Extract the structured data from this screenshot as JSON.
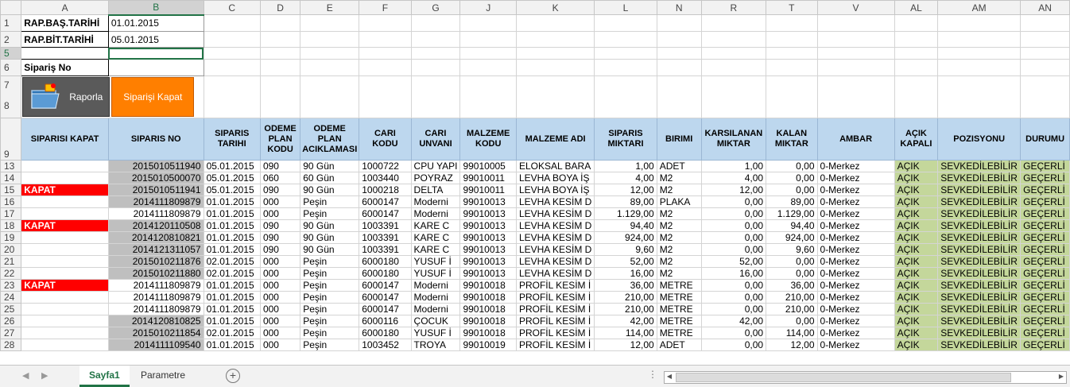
{
  "columns": [
    "A",
    "B",
    "C",
    "D",
    "E",
    "F",
    "G",
    "J",
    "K",
    "L",
    "N",
    "R",
    "T",
    "V",
    "AL",
    "AM",
    "AN"
  ],
  "rows": {
    "r1": {
      "num": "1",
      "label": "RAP.BAŞ.TARİHİ",
      "value": "01.01.2015"
    },
    "r2": {
      "num": "2",
      "label": "RAP.BİT.TARİHİ",
      "value": "05.01.2015"
    },
    "r5": {
      "num": "5"
    },
    "r6": {
      "num": "6",
      "label": "Sipariş No"
    },
    "r7": {
      "num": "7"
    },
    "r8": {
      "num": "8"
    },
    "r9": {
      "num": "9"
    }
  },
  "buttons": {
    "raporla": "Raporla",
    "kapat": "Siparişi Kapat"
  },
  "headers": [
    "SIPARISI KAPAT",
    "SIPARIS NO",
    "SIPARIS TARIHI",
    "ODEME PLAN KODU",
    "ODEME PLAN ACIKLAMASI",
    "CARI KODU",
    "CARI UNVANI",
    "MALZEME KODU",
    "MALZEME ADI",
    "SIPARIS MIKTARI",
    "BIRIMI",
    "KARSILANAN MIKTAR",
    "KALAN MIKTAR",
    "AMBAR",
    "AÇIK KAPALI",
    "POZISYONU",
    "DURUMU"
  ],
  "data_rows": [
    {
      "row": "13",
      "kapat": "",
      "sipno": "2015010511940",
      "gray": true,
      "tarih": "05.01.2015",
      "kod": "090",
      "acik": "90 Gün",
      "cari": "1000722",
      "unvan": "CPU YAPI",
      "mkod": "99010005",
      "madi": "ELOKSAL BARA",
      "mikt": "1,00",
      "birim": "ADET",
      "kars": "1,00",
      "kalan": "0,00",
      "ambar": "0-Merkez",
      "durum": "AÇIK",
      "poz": "SEVKEDİLEBİLİR",
      "gec": "GEÇERLİ"
    },
    {
      "row": "14",
      "kapat": "",
      "sipno": "2015010500070",
      "gray": true,
      "tarih": "05.01.2015",
      "kod": "060",
      "acik": "60 Gün",
      "cari": "1003440",
      "unvan": "POYRAZ",
      "mkod": "99010011",
      "madi": "LEVHA BOYA İŞ",
      "mikt": "4,00",
      "birim": "M2",
      "kars": "4,00",
      "kalan": "0,00",
      "ambar": "0-Merkez",
      "durum": "AÇIK",
      "poz": "SEVKEDİLEBİLİR",
      "gec": "GEÇERLİ"
    },
    {
      "row": "15",
      "kapat": "KAPAT",
      "sipno": "2015010511941",
      "gray": true,
      "tarih": "05.01.2015",
      "kod": "090",
      "acik": "90 Gün",
      "cari": "1000218",
      "unvan": "DELTA",
      "mkod": "99010011",
      "madi": "LEVHA BOYA İŞ",
      "mikt": "12,00",
      "birim": "M2",
      "kars": "12,00",
      "kalan": "0,00",
      "ambar": "0-Merkez",
      "durum": "AÇIK",
      "poz": "SEVKEDİLEBİLİR",
      "gec": "GEÇERLİ"
    },
    {
      "row": "16",
      "kapat": "",
      "sipno": "2014111809879",
      "gray": true,
      "tarih": "01.01.2015",
      "kod": "000",
      "acik": "Peşin",
      "cari": "6000147",
      "unvan": "Moderni",
      "mkod": "99010013",
      "madi": "LEVHA KESİM D",
      "mikt": "89,00",
      "birim": "PLAKA",
      "kars": "0,00",
      "kalan": "89,00",
      "ambar": "0-Merkez",
      "durum": "AÇIK",
      "poz": "SEVKEDİLEBİLİR",
      "gec": "GEÇERLİ"
    },
    {
      "row": "17",
      "kapat": "",
      "sipno": "2014111809879",
      "gray": false,
      "tarih": "01.01.2015",
      "kod": "000",
      "acik": "Peşin",
      "cari": "6000147",
      "unvan": "Moderni",
      "mkod": "99010013",
      "madi": "LEVHA KESİM D",
      "mikt": "1.129,00",
      "birim": "M2",
      "kars": "0,00",
      "kalan": "1.129,00",
      "ambar": "0-Merkez",
      "durum": "AÇIK",
      "poz": "SEVKEDİLEBİLİR",
      "gec": "GEÇERLİ"
    },
    {
      "row": "18",
      "kapat": "KAPAT",
      "sipno": "2014120110508",
      "gray": true,
      "tarih": "01.01.2015",
      "kod": "090",
      "acik": "90 Gün",
      "cari": "1003391",
      "unvan": "KARE C",
      "mkod": "99010013",
      "madi": "LEVHA KESİM D",
      "mikt": "94,40",
      "birim": "M2",
      "kars": "0,00",
      "kalan": "94,40",
      "ambar": "0-Merkez",
      "durum": "AÇIK",
      "poz": "SEVKEDİLEBİLİR",
      "gec": "GEÇERLİ"
    },
    {
      "row": "19",
      "kapat": "",
      "sipno": "2014120810821",
      "gray": true,
      "tarih": "01.01.2015",
      "kod": "090",
      "acik": "90 Gün",
      "cari": "1003391",
      "unvan": "KARE C",
      "mkod": "99010013",
      "madi": "LEVHA KESİM D",
      "mikt": "924,00",
      "birim": "M2",
      "kars": "0,00",
      "kalan": "924,00",
      "ambar": "0-Merkez",
      "durum": "AÇIK",
      "poz": "SEVKEDİLEBİLİR",
      "gec": "GEÇERLİ"
    },
    {
      "row": "20",
      "kapat": "",
      "sipno": "2014121311057",
      "gray": true,
      "tarih": "01.01.2015",
      "kod": "090",
      "acik": "90 Gün",
      "cari": "1003391",
      "unvan": "KARE C",
      "mkod": "99010013",
      "madi": "LEVHA KESİM D",
      "mikt": "9,60",
      "birim": "M2",
      "kars": "0,00",
      "kalan": "9,60",
      "ambar": "0-Merkez",
      "durum": "AÇIK",
      "poz": "SEVKEDİLEBİLİR",
      "gec": "GEÇERLİ"
    },
    {
      "row": "21",
      "kapat": "",
      "sipno": "2015010211876",
      "gray": true,
      "tarih": "02.01.2015",
      "kod": "000",
      "acik": "Peşin",
      "cari": "6000180",
      "unvan": "YUSUF İ",
      "mkod": "99010013",
      "madi": "LEVHA KESİM D",
      "mikt": "52,00",
      "birim": "M2",
      "kars": "52,00",
      "kalan": "0,00",
      "ambar": "0-Merkez",
      "durum": "AÇIK",
      "poz": "SEVKEDİLEBİLİR",
      "gec": "GEÇERLİ"
    },
    {
      "row": "22",
      "kapat": "",
      "sipno": "2015010211880",
      "gray": true,
      "tarih": "02.01.2015",
      "kod": "000",
      "acik": "Peşin",
      "cari": "6000180",
      "unvan": "YUSUF İ",
      "mkod": "99010013",
      "madi": "LEVHA KESİM D",
      "mikt": "16,00",
      "birim": "M2",
      "kars": "16,00",
      "kalan": "0,00",
      "ambar": "0-Merkez",
      "durum": "AÇIK",
      "poz": "SEVKEDİLEBİLİR",
      "gec": "GEÇERLİ"
    },
    {
      "row": "23",
      "kapat": "KAPAT",
      "sipno": "2014111809879",
      "gray": false,
      "tarih": "01.01.2015",
      "kod": "000",
      "acik": "Peşin",
      "cari": "6000147",
      "unvan": "Moderni",
      "mkod": "99010018",
      "madi": "PROFİL KESİM İ",
      "mikt": "36,00",
      "birim": "METRE",
      "kars": "0,00",
      "kalan": "36,00",
      "ambar": "0-Merkez",
      "durum": "AÇIK",
      "poz": "SEVKEDİLEBİLİR",
      "gec": "GEÇERLİ"
    },
    {
      "row": "24",
      "kapat": "",
      "sipno": "2014111809879",
      "gray": false,
      "tarih": "01.01.2015",
      "kod": "000",
      "acik": "Peşin",
      "cari": "6000147",
      "unvan": "Moderni",
      "mkod": "99010018",
      "madi": "PROFİL KESİM İ",
      "mikt": "210,00",
      "birim": "METRE",
      "kars": "0,00",
      "kalan": "210,00",
      "ambar": "0-Merkez",
      "durum": "AÇIK",
      "poz": "SEVKEDİLEBİLİR",
      "gec": "GEÇERLİ"
    },
    {
      "row": "25",
      "kapat": "",
      "sipno": "2014111809879",
      "gray": false,
      "tarih": "01.01.2015",
      "kod": "000",
      "acik": "Peşin",
      "cari": "6000147",
      "unvan": "Moderni",
      "mkod": "99010018",
      "madi": "PROFİL KESİM İ",
      "mikt": "210,00",
      "birim": "METRE",
      "kars": "0,00",
      "kalan": "210,00",
      "ambar": "0-Merkez",
      "durum": "AÇIK",
      "poz": "SEVKEDİLEBİLİR",
      "gec": "GEÇERLİ"
    },
    {
      "row": "26",
      "kapat": "",
      "sipno": "2014120810825",
      "gray": true,
      "tarih": "01.01.2015",
      "kod": "000",
      "acik": "Peşin",
      "cari": "6000116",
      "unvan": "ÇOCUK",
      "mkod": "99010018",
      "madi": "PROFİL KESİM İ",
      "mikt": "42,00",
      "birim": "METRE",
      "kars": "42,00",
      "kalan": "0,00",
      "ambar": "0-Merkez",
      "durum": "AÇIK",
      "poz": "SEVKEDİLEBİLİR",
      "gec": "GEÇERLİ"
    },
    {
      "row": "27",
      "kapat": "",
      "sipno": "2015010211854",
      "gray": true,
      "tarih": "02.01.2015",
      "kod": "000",
      "acik": "Peşin",
      "cari": "6000180",
      "unvan": "YUSUF İ",
      "mkod": "99010018",
      "madi": "PROFİL KESİM İ",
      "mikt": "114,00",
      "birim": "METRE",
      "kars": "0,00",
      "kalan": "114,00",
      "ambar": "0-Merkez",
      "durum": "AÇIK",
      "poz": "SEVKEDİLEBİLİR",
      "gec": "GEÇERLİ"
    },
    {
      "row": "28",
      "kapat": "",
      "sipno": "2014111109540",
      "gray": true,
      "tarih": "01.01.2015",
      "kod": "000",
      "acik": "Peşin",
      "cari": "1003452",
      "unvan": "TROYA",
      "mkod": "99010019",
      "madi": "PROFİL KESİM İ",
      "mikt": "12,00",
      "birim": "ADET",
      "kars": "0,00",
      "kalan": "12,00",
      "ambar": "0-Merkez",
      "durum": "AÇIK",
      "poz": "SEVKEDİLEBİLİR",
      "gec": "GEÇERLİ"
    }
  ],
  "sheet_tabs": {
    "active": "Sayfa1",
    "other": "Parametre"
  },
  "icons": {
    "nav_prev": "triangle-left-icon",
    "nav_next": "triangle-right-icon",
    "add": "plus-circle-icon",
    "raporla": "report-folder-icon"
  },
  "colors": {
    "header_bg": "#bdd7ee",
    "kapat_bg": "#ff0000",
    "green_bg": "#c4d79b",
    "gray_bg": "#bfbfbf",
    "button_orange": "#ff7f00",
    "accent": "#217346"
  }
}
